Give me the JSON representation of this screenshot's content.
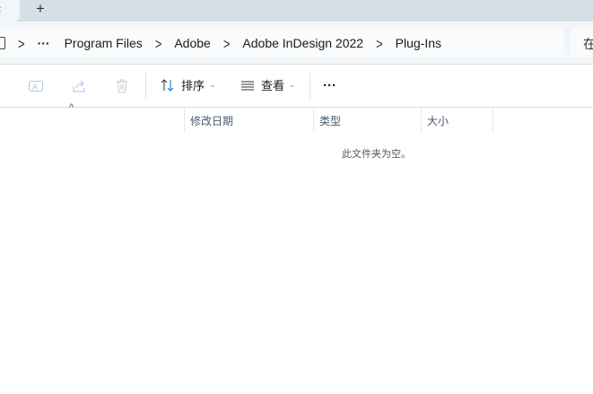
{
  "tabbar": {
    "close_icon": "×",
    "new_tab": "+"
  },
  "breadcrumb": {
    "overflow": "···",
    "items": [
      "Program Files",
      "Adobe",
      "Adobe InDesign 2022",
      "Plug-Ins"
    ]
  },
  "search": {
    "placeholder_partial": "在"
  },
  "toolbar": {
    "sort_label": "排序",
    "view_label": "查看",
    "more_label": "···"
  },
  "columns": [
    "修改日期",
    "类型",
    "大小"
  ],
  "empty_message": "此文件夹为空。"
}
